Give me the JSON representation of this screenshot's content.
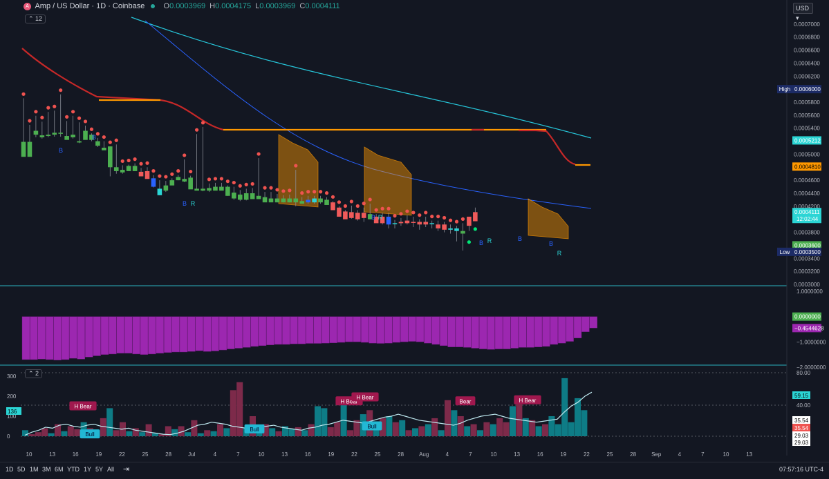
{
  "header": {
    "symbol_letter": "A",
    "title": "Amp / US Dollar · 1D · Coinbase",
    "ohlc": [
      {
        "k": "O",
        "v": "0.0003969"
      },
      {
        "k": "H",
        "v": "0.0004175"
      },
      {
        "k": "L",
        "v": "0.0003969"
      },
      {
        "k": "C",
        "v": "0.0004111"
      }
    ],
    "indicator_count": "12",
    "currency": "USD"
  },
  "colors": {
    "background": "#131722",
    "up": "#26a69a",
    "down": "#ef5350",
    "green_candle": "#4caf50",
    "red_candle": "#f05a5a",
    "blue_candle": "#2962ff",
    "teal": "#2bd5d5",
    "orange": "#ff9800",
    "red_line": "#c62828",
    "blue_line": "#2962ff",
    "cyan_line": "#26c6da",
    "magenta": "#9c27b0",
    "bar_teal": "#0e7c86",
    "bar_maroon": "#7d2a4a"
  },
  "chart_data": [
    {
      "type": "candlestick",
      "title": "Amp / US Dollar · 1D · Coinbase",
      "ylim": [
        0.0003,
        0.00072
      ],
      "y_ticks": [
        "0.0007000",
        "0.0006800",
        "0.0006600",
        "0.0006400",
        "0.0006200",
        "0.0006000",
        "0.0005800",
        "0.0005600",
        "0.0005400",
        "0.0005200",
        "0.0005000",
        "0.0004800",
        "0.0004600",
        "0.0004400",
        "0.0004200",
        "0.0004000",
        "0.0003800",
        "0.0003600",
        "0.0003400",
        "0.0003200",
        "0.0003000"
      ],
      "x_ticks": [
        "10",
        "13",
        "16",
        "19",
        "22",
        "25",
        "28",
        "Jul",
        "4",
        "7",
        "10",
        "13",
        "16",
        "19",
        "22",
        "25",
        "28",
        "Aug",
        "4",
        "7",
        "10",
        "13",
        "16",
        "19",
        "22",
        "25",
        "28",
        "Sep",
        "4",
        "7",
        "10",
        "13"
      ],
      "price_labels": [
        {
          "text": "High",
          "value": "0.0006000",
          "y": 0.0006
        },
        {
          "text": "",
          "value": "0.0005212",
          "y": 0.0005212
        },
        {
          "text": "",
          "value": "0.0004810",
          "y": 0.000481
        },
        {
          "text": "",
          "value": "0.0004111",
          "extra": "12:02:44",
          "y": 0.0004111
        },
        {
          "text": "",
          "value": "0.0003600",
          "y": 0.00036
        },
        {
          "text": "Low",
          "value": "0.0003500",
          "y": 0.00035
        }
      ],
      "candles": [
        [
          0.000519,
          0.000586,
          0.000497,
          0.000496,
          "green"
        ],
        [
          0.000519,
          0.000545,
          0.000513,
          0.000496,
          "green"
        ],
        [
          0.000536,
          0.000559,
          0.000526,
          0.00053,
          "green"
        ],
        [
          0.000529,
          0.00055,
          0.000524,
          0.000526,
          "green"
        ],
        [
          0.00053,
          0.000565,
          0.000526,
          0.000528,
          "green"
        ],
        [
          0.000533,
          0.000567,
          0.000527,
          0.00053,
          "green"
        ],
        [
          0.000533,
          0.000592,
          0.000527,
          0.000532,
          "green"
        ],
        [
          0.000528,
          0.000551,
          0.000524,
          0.000522,
          "green"
        ],
        [
          0.00053,
          0.000559,
          0.000524,
          0.000526,
          "green"
        ],
        [
          0.00052,
          0.000549,
          0.000517,
          0.000518,
          "green"
        ],
        [
          0.000536,
          0.000544,
          0.000529,
          0.000522,
          "green"
        ],
        [
          0.00053,
          0.000532,
          0.00052,
          0.000522,
          "green"
        ],
        [
          0.00052,
          0.000525,
          0.000511,
          0.000513,
          "green"
        ],
        [
          0.00051,
          0.00052,
          0.000508,
          0.000506,
          "green"
        ],
        [
          0.000512,
          0.000512,
          0.000466,
          0.00048,
          "green"
        ],
        [
          0.00048,
          0.000515,
          0.00047,
          0.000474,
          "green"
        ],
        [
          0.000476,
          0.000483,
          0.00047,
          0.000472,
          "green"
        ],
        [
          0.000482,
          0.000484,
          0.000476,
          0.000474,
          "green"
        ],
        [
          0.000482,
          0.000486,
          0.000478,
          0.000474,
          "green"
        ],
        [
          0.000473,
          0.000479,
          0.000466,
          0.000466,
          "red"
        ],
        [
          0.000474,
          0.00048,
          0.000466,
          0.000462,
          "red"
        ],
        [
          0.000463,
          0.000468,
          0.000449,
          0.00045,
          "blue"
        ],
        [
          0.000447,
          0.00046,
          0.000437,
          0.000437,
          "teal"
        ],
        [
          0.000452,
          0.000459,
          0.000442,
          0.000444,
          "green"
        ],
        [
          0.00046,
          0.000463,
          0.000453,
          0.000452,
          "green"
        ],
        [
          0.000465,
          0.000468,
          0.00046,
          0.00046,
          "green"
        ],
        [
          0.000462,
          0.000492,
          0.000457,
          0.000458,
          "green"
        ],
        [
          0.000464,
          0.000467,
          0.000447,
          0.000446,
          "green"
        ],
        [
          0.000447,
          0.000531,
          0.000445,
          0.000444,
          "green"
        ],
        [
          0.000447,
          0.000542,
          0.000443,
          0.000444,
          "green"
        ],
        [
          0.000448,
          0.000455,
          0.000442,
          0.000444,
          "green"
        ],
        [
          0.00045,
          0.000456,
          0.000446,
          0.000444,
          "green"
        ],
        [
          0.00045,
          0.000456,
          0.000446,
          0.000444,
          "green"
        ],
        [
          0.00045,
          0.000452,
          0.000436,
          0.000436,
          "green"
        ],
        [
          0.000441,
          0.00045,
          0.00043,
          0.000432,
          "green"
        ],
        [
          0.000438,
          0.000445,
          0.000428,
          0.00043,
          "green"
        ],
        [
          0.00044,
          0.000447,
          0.000429,
          0.00043,
          "green"
        ],
        [
          0.00044,
          0.000448,
          0.000432,
          0.000431,
          "green"
        ],
        [
          0.000436,
          0.000494,
          0.000432,
          0.000431,
          "green"
        ],
        [
          0.000434,
          0.000442,
          0.000428,
          0.000426,
          "green"
        ],
        [
          0.000432,
          0.000442,
          0.000427,
          0.000426,
          "green"
        ],
        [
          0.000432,
          0.000439,
          0.000426,
          0.000426,
          "green"
        ],
        [
          0.000432,
          0.000437,
          0.000426,
          0.000426,
          "green"
        ],
        [
          0.000432,
          0.000438,
          0.000426,
          0.000426,
          "green"
        ],
        [
          0.000432,
          0.000476,
          0.00042,
          0.000426,
          "green"
        ],
        [
          0.000428,
          0.000434,
          0.000424,
          0.000424,
          "green"
        ],
        [
          0.00043,
          0.000436,
          0.000424,
          0.000426,
          "blue"
        ],
        [
          0.000432,
          0.000436,
          0.000424,
          0.000426,
          "teal"
        ],
        [
          0.000432,
          0.000436,
          0.000424,
          0.000426,
          "green"
        ],
        [
          0.00043,
          0.000434,
          0.000423,
          0.000422,
          "green"
        ],
        [
          0.000426,
          0.000428,
          0.000414,
          0.000414,
          "red"
        ],
        [
          0.000418,
          0.00042,
          0.000404,
          0.000404,
          "red"
        ],
        [
          0.000412,
          0.000414,
          0.000402,
          0.0004,
          "red"
        ],
        [
          0.000411,
          0.000421,
          0.000401,
          0.000402,
          "red"
        ],
        [
          0.00041,
          0.000414,
          0.000398,
          0.0004,
          "red"
        ],
        [
          0.00041,
          0.000418,
          0.000396,
          0.000402,
          "red"
        ],
        [
          0.000408,
          0.000424,
          0.0004,
          0.0004,
          "green"
        ],
        [
          0.000404,
          0.000408,
          0.000396,
          0.000394,
          "red"
        ],
        [
          0.000404,
          0.00041,
          0.000392,
          0.000394,
          "red"
        ],
        [
          0.000404,
          0.00041,
          0.000386,
          0.000392,
          "blue"
        ],
        [
          0.000394,
          0.000399,
          0.000386,
          0.000394,
          "teal"
        ],
        [
          0.000396,
          0.000402,
          0.00039,
          0.000394,
          "red"
        ],
        [
          0.000398,
          0.000406,
          0.000392,
          0.000394,
          "red"
        ],
        [
          0.000396,
          0.000404,
          0.000388,
          0.000396,
          "red"
        ],
        [
          0.000396,
          0.0004,
          0.000384,
          0.000392,
          "red"
        ],
        [
          0.000396,
          0.000404,
          0.000388,
          0.000392,
          "red"
        ],
        [
          0.000394,
          0.000398,
          0.000386,
          0.000394,
          "teal"
        ],
        [
          0.000392,
          0.000398,
          0.000382,
          0.000386,
          "red"
        ],
        [
          0.000392,
          0.000396,
          0.00038,
          0.000384,
          "red"
        ],
        [
          0.000384,
          0.000392,
          0.000378,
          0.000386,
          "teal"
        ],
        [
          0.000386,
          0.00039,
          0.000366,
          0.000382,
          "teal"
        ],
        [
          0.000378,
          0.000394,
          0.000352,
          0.000382,
          "green"
        ],
        [
          0.00039,
          0.000398,
          0.000382,
          0.000404,
          "red"
        ],
        [
          0.000397,
          0.000418,
          0.000397,
          0.000411,
          "red"
        ]
      ]
    },
    {
      "type": "bar",
      "ylim": [
        -2.0,
        1.0
      ],
      "y_ticks": [
        "1.0000000",
        "−1.0000000",
        "−2.0000000"
      ],
      "price_labels": [
        {
          "value": "0.0000000",
          "y": 0.0
        },
        {
          "value": "−0.4544628",
          "y": -0.4544628
        }
      ],
      "values": [
        -1.7,
        -1.7,
        -1.68,
        -1.7,
        -1.72,
        -1.7,
        -1.65,
        -1.68,
        -1.6,
        -1.55,
        -1.5,
        -1.48,
        -1.45,
        -1.45,
        -1.48,
        -1.5,
        -1.48,
        -1.45,
        -1.42,
        -1.4,
        -1.4,
        -1.38,
        -1.35,
        -1.38,
        -1.36,
        -1.32,
        -1.28,
        -1.25,
        -1.22,
        -1.18,
        -1.15,
        -1.12,
        -1.1,
        -1.1,
        -1.08,
        -1.08,
        -1.06,
        -1.06,
        -1.05,
        -1.04,
        -1.02,
        -1.0,
        -1.0,
        -1.02,
        -1.05,
        -1.06,
        -1.05,
        -1.02,
        -1.0,
        -0.98,
        -1.0,
        -1.05,
        -1.1,
        -1.15,
        -1.2,
        -1.2,
        -1.22,
        -1.25,
        -1.28,
        -1.3,
        -1.28,
        -1.28,
        -1.25,
        -1.22,
        -1.22,
        -1.2,
        -1.18,
        -1.1,
        -1.05,
        -0.98,
        -0.85,
        -0.6,
        -0.45
      ]
    },
    {
      "type": "bar",
      "ylim": [
        0,
        300
      ],
      "y_ticks": [
        "300",
        "200",
        "100",
        "0"
      ],
      "right_ticks": [
        "80.00",
        "40.00",
        "29.03"
      ],
      "price_labels": [
        {
          "value": "136",
          "side": "left",
          "y": 136
        },
        {
          "value": "59.15",
          "y": 59.15
        },
        {
          "value": "35.54",
          "y": 35.54
        },
        {
          "value": "35.54",
          "red": true,
          "y": 35.54
        },
        {
          "value": "29.03",
          "y": 29.03
        },
        {
          "value": "29.03",
          "y": 29.03
        }
      ],
      "values": [
        30,
        10,
        20,
        40,
        15,
        60,
        25,
        50,
        35,
        70,
        40,
        25,
        90,
        140,
        30,
        70,
        25,
        40,
        20,
        60,
        15,
        10,
        50,
        35,
        50,
        20,
        80,
        15,
        30,
        25,
        60,
        40,
        230,
        270,
        40,
        100,
        30,
        60,
        40,
        25,
        50,
        35,
        45,
        30,
        60,
        150,
        140,
        45,
        70,
        160,
        30,
        80,
        110,
        130,
        60,
        90,
        100,
        70,
        80,
        30,
        40,
        50,
        60,
        90,
        30,
        180,
        130,
        100,
        50,
        60,
        30,
        70,
        60,
        90,
        70,
        150,
        160,
        90,
        80,
        50,
        60,
        100,
        60,
        290,
        70,
        190,
        130
      ],
      "bar_colors": [
        "t",
        "m",
        "m",
        "m",
        "t",
        "m",
        "t",
        "m",
        "m",
        "t",
        "m",
        "t",
        "m",
        "t",
        "m",
        "m",
        "t",
        "m",
        "t",
        "m",
        "t",
        "m",
        "m",
        "t",
        "m",
        "t",
        "m",
        "t",
        "m",
        "t",
        "m",
        "t",
        "m",
        "m",
        "t",
        "m",
        "t",
        "m",
        "t",
        "m",
        "t",
        "t",
        "m",
        "t",
        "m",
        "t",
        "t",
        "m",
        "m",
        "t",
        "m",
        "m",
        "t",
        "m",
        "t",
        "m",
        "t",
        "m",
        "t",
        "m",
        "t",
        "m",
        "t",
        "m",
        "t",
        "m",
        "t",
        "m",
        "t",
        "m",
        "t",
        "m",
        "t",
        "m",
        "m",
        "t",
        "m",
        "t",
        "m",
        "t",
        "m",
        "t",
        "t",
        "t",
        "t",
        "t",
        "t"
      ],
      "line": [
        5,
        20,
        30,
        45,
        40,
        55,
        60,
        50,
        45,
        55,
        60,
        50,
        45,
        40,
        35,
        40,
        30,
        25,
        20,
        15,
        10,
        8,
        15,
        25,
        40,
        55,
        60,
        70,
        65,
        60,
        50,
        45,
        40,
        35,
        45,
        50,
        55,
        45,
        40,
        35,
        30,
        40,
        45,
        55,
        60,
        70,
        80,
        75,
        70,
        65,
        75,
        85,
        95,
        100,
        110,
        100,
        90,
        80,
        75,
        70,
        65,
        60,
        55,
        65,
        80,
        90,
        100,
        105,
        110,
        100,
        90,
        85,
        80,
        75,
        70,
        75,
        80,
        85,
        120,
        150,
        170,
        200,
        220
      ],
      "annotations": [
        {
          "text": "H Bear",
          "color": "#a0184e",
          "x": 120,
          "y": 150
        },
        {
          "text": "Bull",
          "color": "#22b8d4",
          "x": 130,
          "y": 10
        },
        {
          "text": "Bull",
          "color": "#22b8d4",
          "x": 368,
          "y": 35
        },
        {
          "text": "H Bear",
          "color": "#a0184e",
          "x": 505,
          "y": 175
        },
        {
          "text": "H Bear",
          "color": "#a0184e",
          "x": 528,
          "y": 195
        },
        {
          "text": "Bull",
          "color": "#22b8d4",
          "x": 538,
          "y": 50
        },
        {
          "text": "Bear",
          "color": "#a0184e",
          "x": 673,
          "y": 175
        },
        {
          "text": "H Bear",
          "color": "#a0184e",
          "x": 763,
          "y": 180
        }
      ]
    }
  ],
  "signals": {
    "B": "B",
    "R": "R"
  },
  "toolbar": {
    "ranges": [
      "1D",
      "5D",
      "1M",
      "3M",
      "6M",
      "YTD",
      "1Y",
      "5Y",
      "All"
    ],
    "clock": "07:57:16 UTC-4",
    "pane_count": "2"
  }
}
